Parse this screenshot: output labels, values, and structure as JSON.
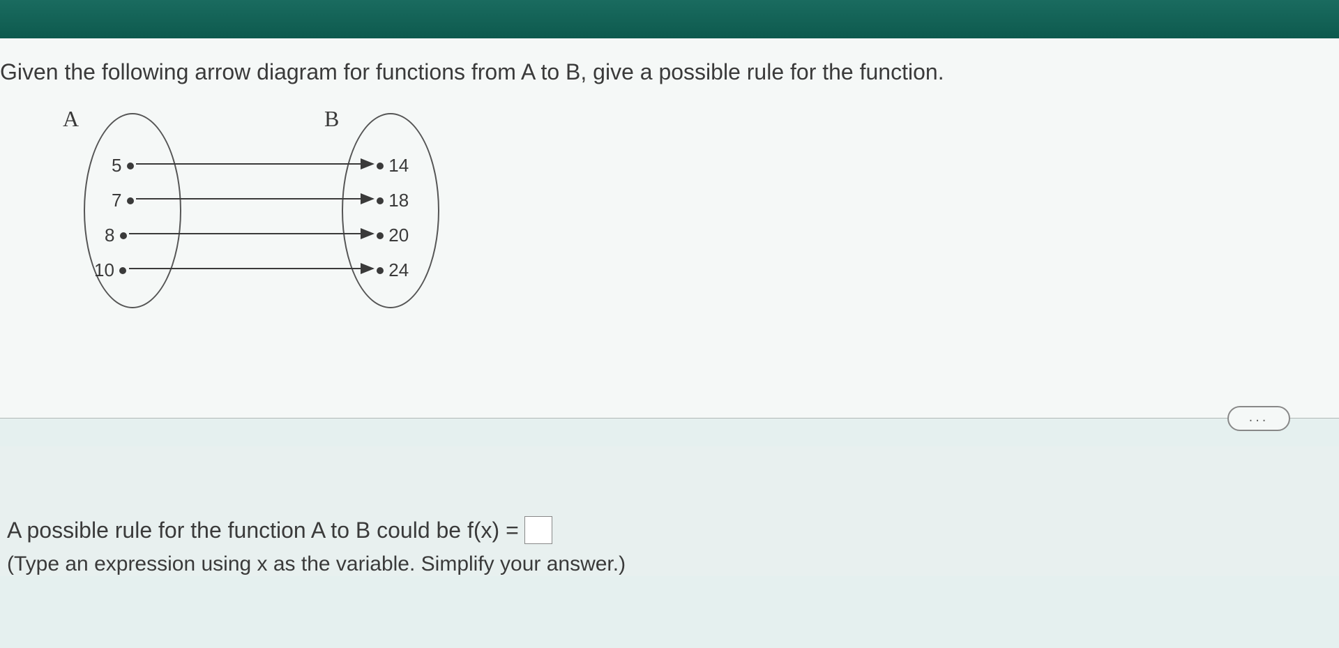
{
  "question": "Given the following arrow diagram for functions from A to B, give a possible rule for the function.",
  "diagram": {
    "setA": {
      "label": "A",
      "values": [
        "5",
        "7",
        "8",
        "10"
      ]
    },
    "setB": {
      "label": "B",
      "values": [
        "14",
        "18",
        "20",
        "24"
      ]
    },
    "mappings": [
      {
        "from": "5",
        "to": "14"
      },
      {
        "from": "7",
        "to": "18"
      },
      {
        "from": "8",
        "to": "20"
      },
      {
        "from": "10",
        "to": "24"
      }
    ]
  },
  "answer": {
    "prefix": "A possible rule for the function A to B could be f(x) =",
    "hint": "(Type an expression using x as the variable. Simplify your answer.)"
  },
  "moreButton": "..."
}
